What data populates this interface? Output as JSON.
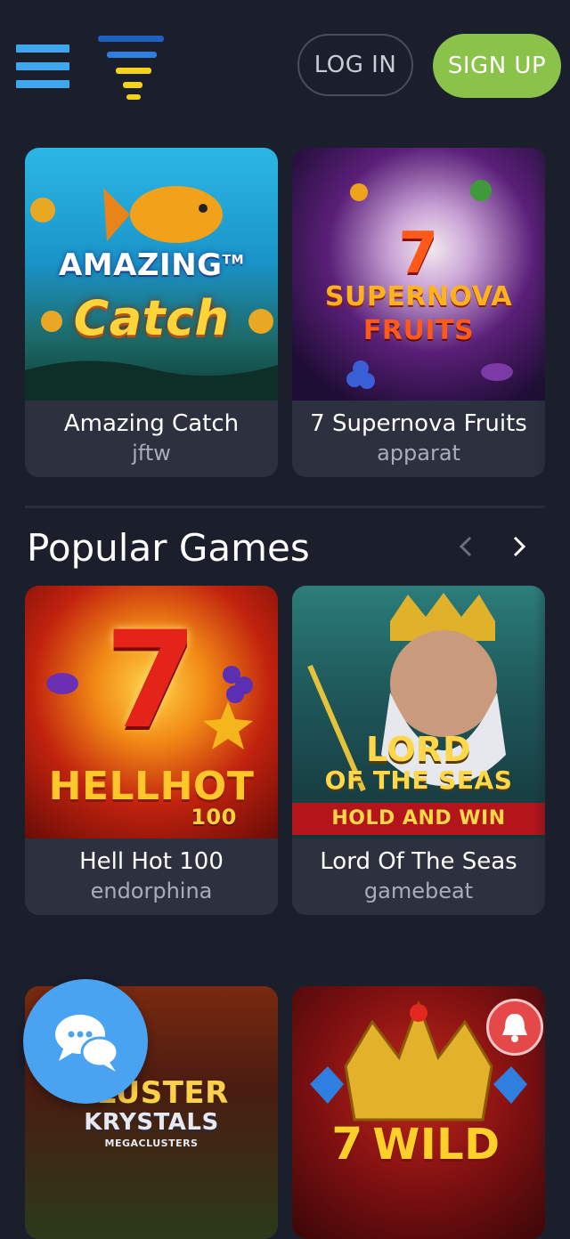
{
  "header": {
    "login_label": "LOG IN",
    "signup_label": "SIGN UP",
    "logo_colors": [
      "#1f5fbf",
      "#2f7fe0",
      "#f5d21e",
      "#f5d21e"
    ]
  },
  "top_games": [
    {
      "title": "Amazing Catch",
      "provider": "jftw",
      "art_line1": "AMAZING",
      "art_tm": "TM",
      "art_line2": "Catch"
    },
    {
      "title": "7 Supernova Fruits",
      "provider": "apparat",
      "art_digit": "7",
      "art_line1": "SUPERNOVA",
      "art_line2": "FRUITS"
    }
  ],
  "popular": {
    "section_title": "Popular Games",
    "prev_icon": "chevron-left-icon",
    "next_icon": "chevron-right-icon",
    "games": [
      {
        "title": "Hell Hot 100",
        "provider": "endorphina",
        "art_digit": "7",
        "art_line1": "HELLHOT",
        "art_line2": "100"
      },
      {
        "title": "Lord Of The Seas",
        "provider": "gamebeat",
        "art_line1": "LORD",
        "art_line2": "OF THE SEAS",
        "art_line3": "HOLD AND WIN"
      }
    ]
  },
  "bottom_games": [
    {
      "art_line1": "CLUSTER",
      "art_line2": "KRYSTALS",
      "art_line3": "MEGACLUSTERS"
    },
    {
      "art_digit": "7",
      "art_line1": "WILD"
    }
  ],
  "floating": {
    "chat_icon": "chat-bubbles-icon",
    "bell_icon": "bell-icon"
  },
  "colors": {
    "background": "#1b1e2b",
    "card": "#2d313f",
    "accent_blue": "#3fa7f0",
    "signup_green": "#8bc34a",
    "notification_red": "#e54848"
  }
}
